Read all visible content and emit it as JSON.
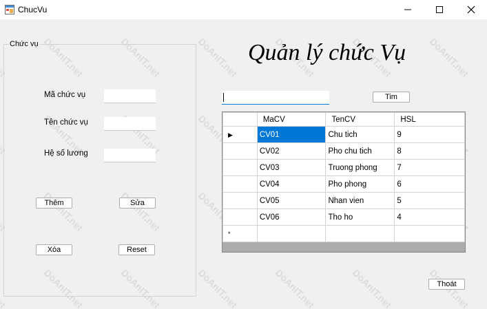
{
  "window": {
    "title": "ChucVu",
    "icon": "form-icon",
    "controls": [
      "minimize-icon",
      "maximize-icon",
      "close-icon"
    ]
  },
  "group": {
    "legend": "Chức vụ"
  },
  "form": {
    "ma_label": "Mã chức vụ",
    "ma_value": "",
    "ten_label": "Tên chức vụ",
    "ten_value": "",
    "hsl_label": "Hệ số lương",
    "hsl_value": ""
  },
  "buttons": {
    "them": "Thêm",
    "sua": "Sửa",
    "xoa": "Xóa",
    "reset": "Reset",
    "tim": "Tim",
    "thoat": "Thoát"
  },
  "heading": "Quản lý chức Vụ",
  "search": {
    "value": ""
  },
  "grid": {
    "columns": [
      "MaCV",
      "TenCV",
      "HSL"
    ],
    "rows": [
      [
        "CV01",
        "Chu tich",
        "9"
      ],
      [
        "CV02",
        "Pho chu tich",
        "8"
      ],
      [
        "CV03",
        "Truong phong",
        "7"
      ],
      [
        "CV04",
        "Pho phong",
        "6"
      ],
      [
        "CV05",
        "Nhan vien",
        "5"
      ],
      [
        "CV06",
        "Tho ho",
        "4"
      ]
    ],
    "current_row_marker": "▶",
    "new_row_marker": "*",
    "selection_color": "#0078d7"
  },
  "watermark": "DoAnIT.net"
}
